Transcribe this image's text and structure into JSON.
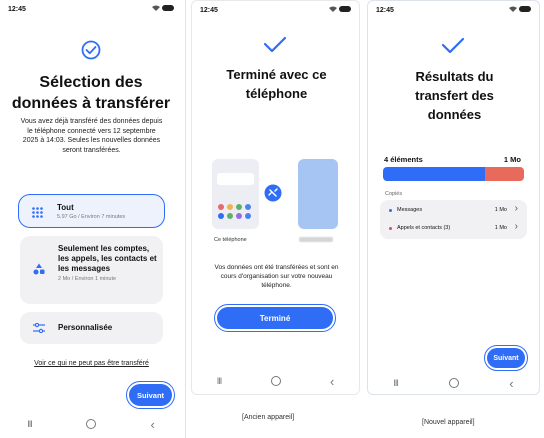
{
  "status": {
    "time": "12:45"
  },
  "screen1": {
    "title": "Sélection des données à transférer",
    "description": "Vous avez déjà transféré des données depuis le téléphone connecté vers 12 septembre 2025 à 14:03. Seules les nouvelles données seront transférées.",
    "options": [
      {
        "label": "Tout",
        "sub": "5.97 Go / Environ 7 minutes"
      },
      {
        "label": "Seulement les comptes, les appels, les contacts et les messages",
        "sub": "2 Mo / Environ 1 minute"
      },
      {
        "label": "Personnalisée",
        "sub": ""
      }
    ],
    "link": "Voir ce qui ne peut pas être transféré",
    "next_button": "Suivant"
  },
  "screen2": {
    "title": "Terminé avec ce téléphone",
    "device_label": "Ce téléphone",
    "message": "Vos données ont été transférées et sont en cours d'organisation sur votre nouveau téléphone.",
    "done_button": "Terminé",
    "caption": "[Ancien appareil]"
  },
  "screen3": {
    "title": "Résultats du transfert des données",
    "count": "4 éléments",
    "size": "1 Mo",
    "section": "Copiés",
    "rows": [
      {
        "label": "Messages",
        "size": "1 Mo",
        "dot": "#2f6df6"
      },
      {
        "label": "Appels et contacts (3)",
        "size": "1 Mo",
        "dot": "#e24b4b"
      }
    ],
    "next_button": "Suivant",
    "caption": "[Nouvel appareil]"
  },
  "colors": {
    "accent": "#2f6df6",
    "red": "#e86a5a"
  },
  "bar_fractions": {
    "blue": 0.72,
    "red": 0.28
  }
}
